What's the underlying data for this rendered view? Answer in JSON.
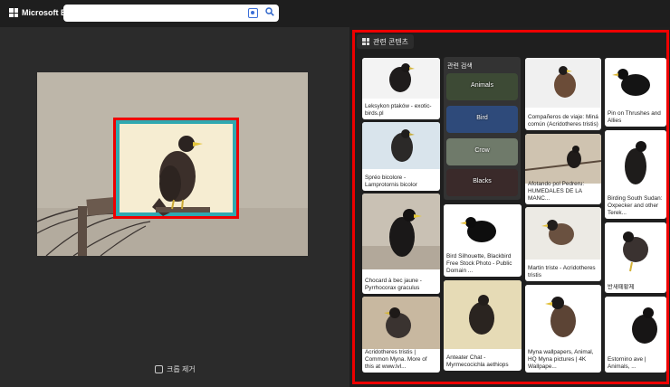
{
  "header": {
    "brand": "Microsoft Bing",
    "search": {
      "value": "",
      "placeholder": ""
    }
  },
  "left": {
    "remove_crop_label": "크롭 제거"
  },
  "right": {
    "tab_label": "관련 콘텐츠",
    "related_searches": {
      "title": "관련 검색",
      "items": [
        "Animals",
        "Bird",
        "Crow",
        "Blacks"
      ]
    },
    "cards": [
      {
        "caption": "Leksykon ptaków - exotic-birds.pl"
      },
      {
        "caption": "Spréo bicolore - Lamprotornis bicolor"
      },
      {
        "caption": "Chocard à bec jaune - Pyrrhocorax graculus"
      },
      {
        "caption": "Acridotheres tristis | Common Myna. More of this at www.lvl..."
      },
      {
        "caption": "Bird Silhouette, Blackbird Free Stock Photo - Public Domain ..."
      },
      {
        "caption": "Anteater Chat - Myrmecocichla aethiops"
      },
      {
        "caption": "Compañeros de viaje: Miná común (Acridotheres tristis)"
      },
      {
        "caption": "Afotando pol Pedreru: HUMEDALES DE LA MANC..."
      },
      {
        "caption": "Martin triste - Acridotheres tristis"
      },
      {
        "caption": "Myna wallpapers, Animal, HQ Myna pictures | 4K Wallpape..."
      },
      {
        "caption": "Pin on Thrushes and Allies"
      },
      {
        "caption": "Birding South Sudan: Oxpecker and other Terek..."
      },
      {
        "caption": "반새떼황제"
      },
      {
        "caption": "Estornino ave | Animals, ..."
      }
    ]
  }
}
